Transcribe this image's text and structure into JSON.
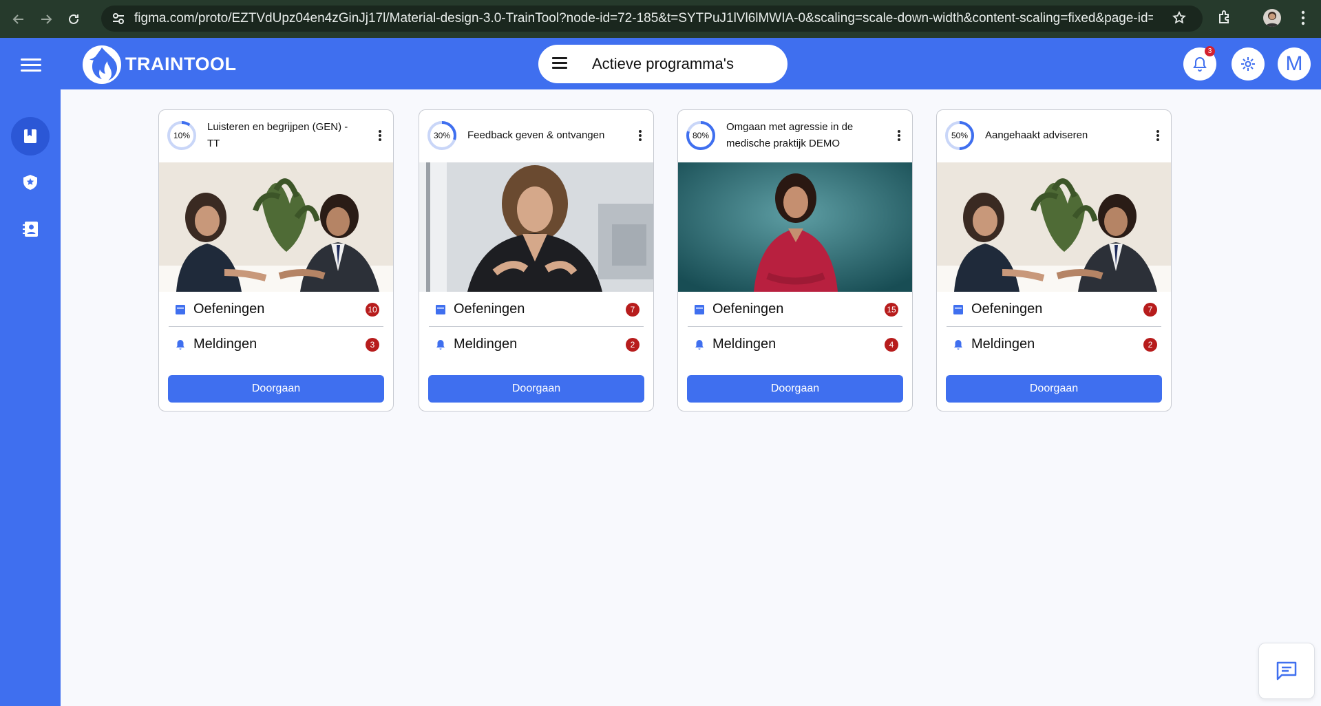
{
  "browser": {
    "url": "figma.com/proto/EZTVdUpz04en4zGinJj17l/Material-design-3.0-TrainTool?node-id=72-185&t=SYTPuJ1lVl6lMWIA-0&scaling=scale-down-width&content-scaling=fixed&page-id=0%3A1&start..."
  },
  "header": {
    "logo_text": "TRAINTOOL",
    "program_title": "Actieve programma's",
    "notification_count": "3",
    "avatar_letter": "M"
  },
  "colors": {
    "primary": "#3f6fef",
    "badge": "#b71c1c",
    "browser_bar": "#263a2c"
  },
  "sidebar": {
    "items": [
      {
        "icon": "bookmark-icon",
        "active": true
      },
      {
        "icon": "shield-star-icon",
        "active": false
      },
      {
        "icon": "contact-book-icon",
        "active": false
      }
    ]
  },
  "cards": [
    {
      "progress": "10%",
      "progress_value": 0.1,
      "title": "Luisteren en begrijpen (GEN) - TT",
      "image": "two-people-conversation",
      "rows": [
        {
          "label": "Oefeningen",
          "count": "10",
          "icon": "calendar-icon"
        },
        {
          "label": "Meldingen",
          "count": "3",
          "icon": "bell-icon"
        }
      ],
      "button": "Doorgaan"
    },
    {
      "progress": "30%",
      "progress_value": 0.3,
      "title": "Feedback geven & ontvangen",
      "image": "woman-speaking-office",
      "rows": [
        {
          "label": "Oefeningen",
          "count": "7",
          "icon": "calendar-icon"
        },
        {
          "label": "Meldingen",
          "count": "2",
          "icon": "bell-icon"
        }
      ],
      "button": "Doorgaan"
    },
    {
      "progress": "80%",
      "progress_value": 0.8,
      "title": "Omgaan met agressie in de medische praktijk DEMO",
      "image": "woman-red-shirt-teal-background",
      "rows": [
        {
          "label": "Oefeningen",
          "count": "15",
          "icon": "calendar-icon"
        },
        {
          "label": "Meldingen",
          "count": "4",
          "icon": "bell-icon"
        }
      ],
      "button": "Doorgaan"
    },
    {
      "progress": "50%",
      "progress_value": 0.5,
      "title": "Aangehaakt adviseren",
      "image": "two-people-conversation",
      "rows": [
        {
          "label": "Oefeningen",
          "count": "7",
          "icon": "calendar-icon"
        },
        {
          "label": "Meldingen",
          "count": "2",
          "icon": "bell-icon"
        }
      ],
      "button": "Doorgaan"
    }
  ]
}
